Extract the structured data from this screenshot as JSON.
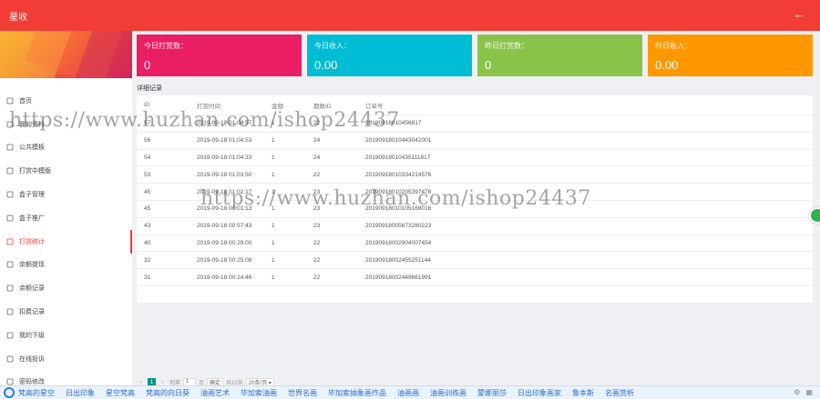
{
  "topbar": {
    "title": "星收",
    "back_icon": "arrow-left-icon"
  },
  "sidebar": {
    "items": [
      {
        "label": "首页",
        "icon": "home-icon"
      },
      {
        "label": "我的资料",
        "icon": "profile-icon"
      },
      {
        "label": "公共模板",
        "icon": "template-icon"
      },
      {
        "label": "打赏中模版",
        "icon": "reward-template-icon"
      },
      {
        "label": "盒子管理",
        "icon": "box-icon"
      },
      {
        "label": "盒子推广",
        "icon": "promote-icon"
      },
      {
        "label": "打赏统计",
        "icon": "stats-icon",
        "active": true
      },
      {
        "label": "余额提现",
        "icon": "withdraw-icon"
      },
      {
        "label": "余额记录",
        "icon": "balance-log-icon"
      },
      {
        "label": "扣费记录",
        "icon": "deduct-icon"
      },
      {
        "label": "我的下级",
        "icon": "team-icon"
      },
      {
        "label": "在线投诉",
        "icon": "complaint-icon"
      },
      {
        "label": "密码修改",
        "icon": "password-icon"
      }
    ]
  },
  "cards": [
    {
      "label": "今日打赏数：",
      "value": "0",
      "color": "#e91e63"
    },
    {
      "label": "今日收入：",
      "value": "0.00",
      "color": "#00bcd4"
    },
    {
      "label": "昨日打赏数：",
      "value": "0",
      "color": "#8bc34a"
    },
    {
      "label": "昨日收入：",
      "value": "0.00",
      "color": "#ff9800"
    }
  ],
  "table": {
    "title": "详细记录",
    "headers": [
      "ID",
      "打赏时间",
      "金额",
      "期数ID",
      "订单号"
    ],
    "rows": [
      [
        "57",
        "2019-09-18 01:04:57",
        "1",
        "22",
        "20190918010456817"
      ],
      [
        "56",
        "2019-09-18 01:04:53",
        "1",
        "24",
        "20190918010443042001"
      ],
      [
        "54",
        "2019-09-18 01:04:33",
        "1",
        "24",
        "20190918010435111817"
      ],
      [
        "53",
        "2019-09-18 01:03:50",
        "1",
        "22",
        "20190918010334214576"
      ],
      [
        "45",
        "2019-09-18 01:02:17",
        "1",
        "23",
        "20190918010205397478"
      ],
      [
        "45",
        "2019-09-18 01:01:13",
        "1",
        "23",
        "20190918010105168016"
      ],
      [
        "43",
        "2019-09-18 00:57:43",
        "1",
        "23",
        "20190918005673280223"
      ],
      [
        "40",
        "2019-09-18 00:29:00",
        "1",
        "22",
        "20190918002904007454"
      ],
      [
        "32",
        "2019-09-18 00:25:08",
        "1",
        "22",
        "20190918002455251144"
      ],
      [
        "31",
        "2019-09-18 00:24:46",
        "1",
        "22",
        "20190918002449661991"
      ]
    ]
  },
  "pager": {
    "prev": "‹",
    "current": "1",
    "next": "›",
    "goto_label": "到第",
    "page_value": "1",
    "page_unit": "页",
    "confirm": "确定",
    "total": "共10条",
    "per_page": "20条/页 ▾"
  },
  "bottombar": {
    "links": [
      "梵高的星空",
      "日出印象",
      "星空梵高",
      "梵高的向日葵",
      "油画艺术",
      "毕加索油画",
      "世界名画",
      "毕加索抽象画作品",
      "油画画",
      "油画训练画",
      "蒙娜丽莎",
      "日出印象画家",
      "鲁本斯",
      "名画赏析"
    ]
  },
  "watermark": "https://www.huzhan.com/ishop24437"
}
